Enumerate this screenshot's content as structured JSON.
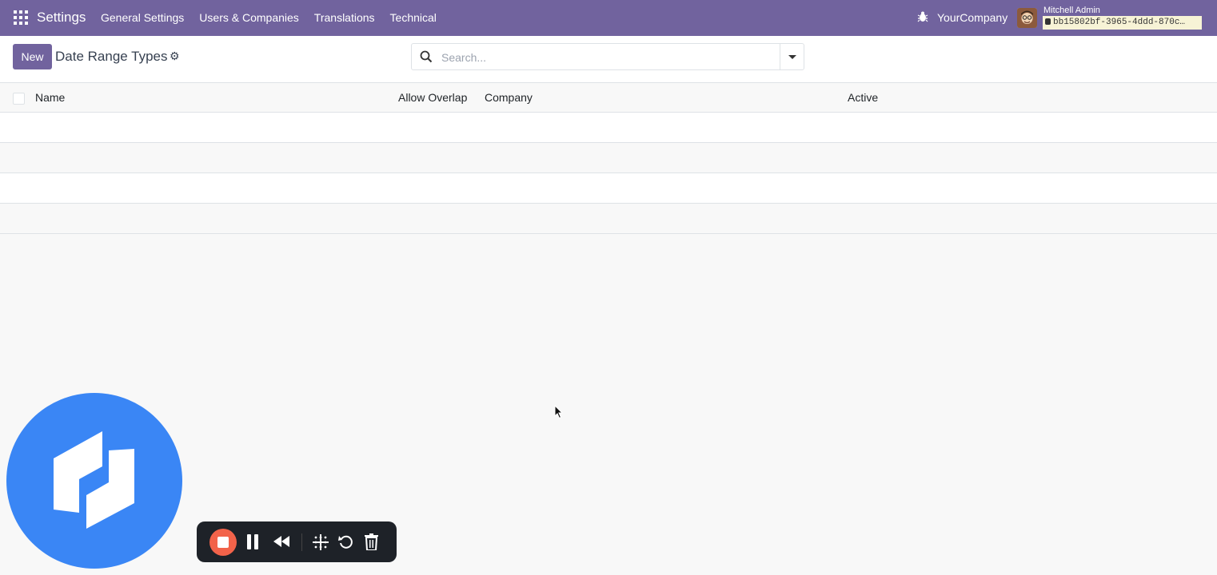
{
  "navbar": {
    "app_name": "Settings",
    "menu": [
      "General Settings",
      "Users & Companies",
      "Translations",
      "Technical"
    ],
    "company": "YourCompany",
    "user_name": "Mitchell Admin",
    "database": "bb15802bf-3965-4ddd-870c…"
  },
  "control": {
    "new_label": "New",
    "title": "Date Range Types",
    "search_placeholder": "Search..."
  },
  "list": {
    "columns": [
      "Name",
      "Allow Overlap",
      "Company",
      "Active"
    ],
    "rows": 4
  },
  "colors": {
    "brand": "#71639e",
    "record_stop": "#f2634a",
    "logo_blue": "#3a86f5"
  },
  "recorder": {
    "icons": [
      "stop-icon",
      "pause-icon",
      "rewind-icon",
      "grid-icon",
      "restart-icon",
      "trash-icon"
    ]
  }
}
